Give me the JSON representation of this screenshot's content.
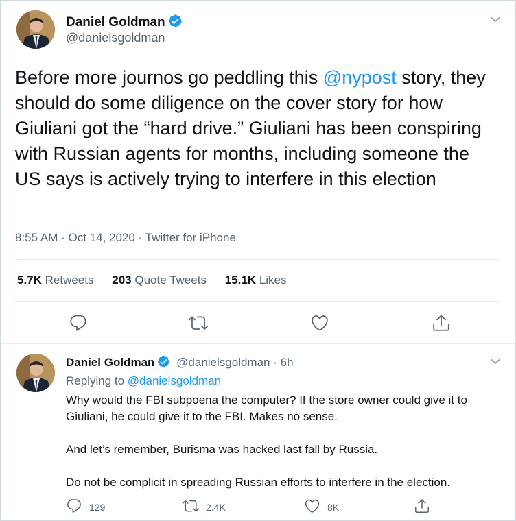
{
  "main_tweet": {
    "author": "Daniel Goldman",
    "handle": "@danielsgoldman",
    "text_before": "Before more journos go peddling this ",
    "mention": "@nypost",
    "text_after": " story, they should do some diligence on the cover story for how Giuliani got the “hard drive.”  Giuliani has been conspiring with Russian agents for months, including someone the US says is actively trying to interfere in this election",
    "time": "8:55 AM",
    "date": "Oct 14, 2020",
    "source": "Twitter for iPhone",
    "retweets_count": "5.7K",
    "retweets_label": "Retweets",
    "quotes_count": "203",
    "quotes_label": "Quote Tweets",
    "likes_count": "15.1K",
    "likes_label": "Likes"
  },
  "reply_tweet": {
    "author": "Daniel Goldman",
    "handle": "@danielsgoldman",
    "age": "6h",
    "replying_label": "Replying to ",
    "replying_to": "@danielsgoldman",
    "paragraphs": [
      "Why would the FBI subpoena the computer? If the store owner could give it to Giuliani, he could give it to the FBI. Makes no sense.",
      "And let’s remember, Burisma was hacked last fall by Russia.",
      "Do not be complicit in spreading Russian efforts to interfere in the election."
    ],
    "replies_count": "129",
    "retweets_count": "2.4K",
    "likes_count": "8K"
  },
  "icons": {
    "verified": "verified-badge-icon",
    "chevron": "chevron-down-icon",
    "reply": "reply-icon",
    "retweet": "retweet-icon",
    "like": "heart-icon",
    "share": "share-icon"
  },
  "colors": {
    "accent": "#1d9bf0",
    "secondary_text": "#536471"
  }
}
